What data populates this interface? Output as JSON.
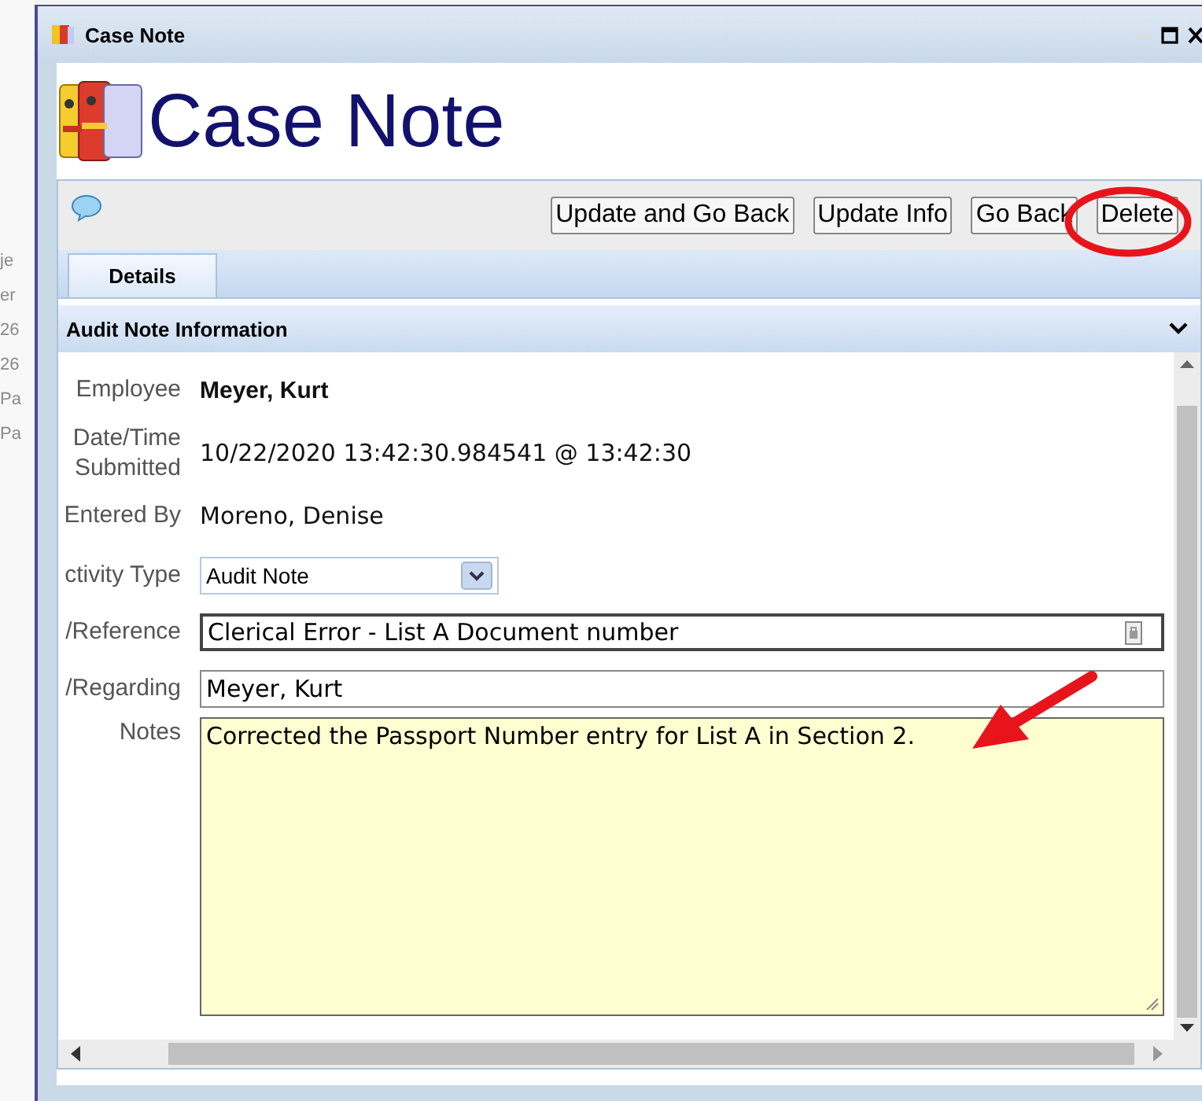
{
  "background": {
    "fragments": [
      "je",
      "er",
      "26",
      "26",
      "Pa",
      "Pa"
    ]
  },
  "window": {
    "title": "Case Note"
  },
  "page_title": "Case Note",
  "toolbar": {
    "buttons": [
      {
        "label": "Update and Go Back"
      },
      {
        "label": "Update Info"
      },
      {
        "label": "Go Back"
      },
      {
        "label": "Delete"
      }
    ]
  },
  "tabs": [
    {
      "label": "Details",
      "selected": true
    }
  ],
  "section": {
    "title": "Audit Note Information",
    "expanded": true
  },
  "fields": [
    {
      "kind": "bold",
      "label": "Employee",
      "value": "Meyer, Kurt"
    },
    {
      "kind": "text",
      "label": "Date/Time Submitted",
      "value": "10/22/2020 13:42:30.984541 @ 13:42:30"
    },
    {
      "kind": "text",
      "label": "Entered By",
      "value": "Moreno, Denise"
    },
    {
      "kind": "select",
      "label": "ctivity Type",
      "value": "Audit Note"
    },
    {
      "kind": "input",
      "label": "/Reference",
      "value": "Clerical Error - List A Document number",
      "focused": true
    },
    {
      "kind": "input",
      "label": "/Regarding",
      "value": "Meyer, Kurt",
      "focused": false
    },
    {
      "kind": "textarea",
      "label": "Notes",
      "value": "Corrected the Passport Number entry for List A in Section 2."
    }
  ]
}
